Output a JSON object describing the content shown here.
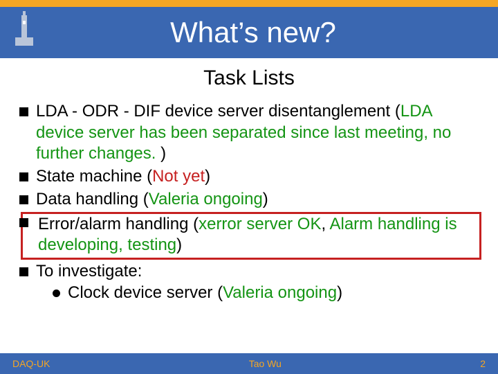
{
  "title": "What’s new?",
  "subtitle": "Task Lists",
  "items": {
    "lda_pre": "LDA - ODR - DIF device server disentanglement (",
    "lda_green": "LDA device server has been separated since last meeting, no further changes.",
    "lda_close": " )",
    "sm_pre": "State machine (",
    "sm_red": "Not yet",
    "sm_close": ")",
    "dh_pre": "Data handling (",
    "dh_green": "Valeria ongoing",
    "dh_close": ")",
    "ea_pre": "Error/alarm handling (",
    "ea_ok": "xerror server OK",
    "ea_sep": ", ",
    "ea_dev": "Alarm handling is developing, testing",
    "ea_close": ")",
    "inv": "To investigate:",
    "inv_sub_pre": "Clock device server (",
    "inv_sub_green": "Valeria ongoing",
    "inv_sub_close": ")"
  },
  "footer": {
    "left": "DAQ-UK",
    "center": "Tao Wu",
    "right": "2"
  }
}
